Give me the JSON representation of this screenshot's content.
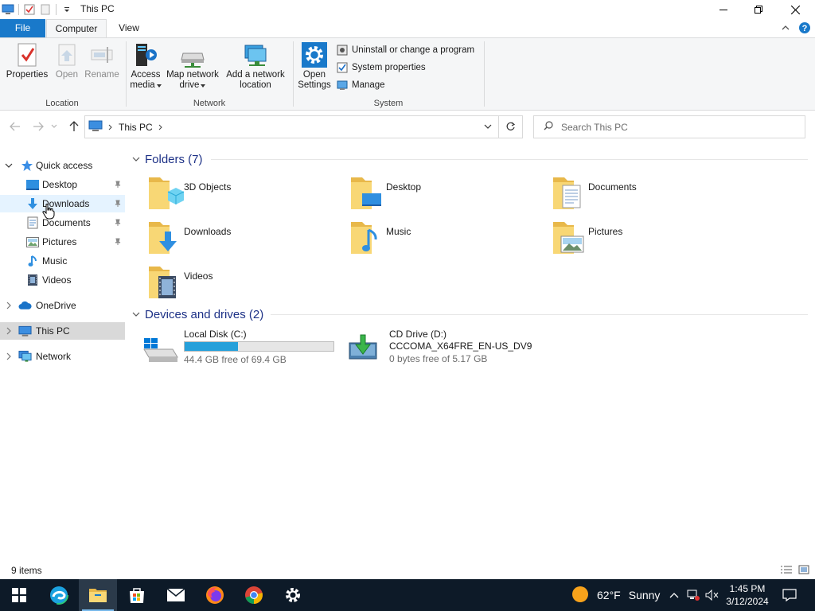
{
  "window": {
    "title": "This PC"
  },
  "ribbon": {
    "tabs": [
      {
        "label": "File"
      },
      {
        "label": "Computer"
      },
      {
        "label": "View"
      }
    ],
    "groups": {
      "location": {
        "label": "Location",
        "buttons": [
          {
            "label": "Properties"
          },
          {
            "label": "Open"
          },
          {
            "label": "Rename"
          }
        ]
      },
      "network": {
        "label": "Network",
        "buttons": [
          {
            "label1": "Access",
            "label2": "media"
          },
          {
            "label1": "Map network",
            "label2": "drive"
          },
          {
            "label1": "Add a network",
            "label2": "location"
          }
        ]
      },
      "system": {
        "label": "System",
        "open_settings_1": "Open",
        "open_settings_2": "Settings",
        "small": [
          {
            "label": "Uninstall or change a program"
          },
          {
            "label": "System properties"
          },
          {
            "label": "Manage"
          }
        ]
      }
    }
  },
  "address": {
    "crumb": "This PC",
    "search_placeholder": "Search This PC"
  },
  "navpane": {
    "items": [
      {
        "label": "Quick access"
      },
      {
        "label": "Desktop"
      },
      {
        "label": "Downloads"
      },
      {
        "label": "Documents"
      },
      {
        "label": "Pictures"
      },
      {
        "label": "Music"
      },
      {
        "label": "Videos"
      },
      {
        "label": "OneDrive"
      },
      {
        "label": "This PC"
      },
      {
        "label": "Network"
      }
    ]
  },
  "content": {
    "folders_header": "Folders (7)",
    "folders": [
      {
        "label": "3D Objects"
      },
      {
        "label": "Desktop"
      },
      {
        "label": "Documents"
      },
      {
        "label": "Downloads"
      },
      {
        "label": "Music"
      },
      {
        "label": "Pictures"
      },
      {
        "label": "Videos"
      }
    ],
    "drives_header": "Devices and drives (2)",
    "drives": [
      {
        "name": "Local Disk (C:)",
        "free": "44.4 GB free of 69.4 GB",
        "used_fraction": 0.36
      },
      {
        "name": "CD Drive (D:)",
        "label": "CCCOMA_X64FRE_EN-US_DV9",
        "free": "0 bytes free of 5.17 GB"
      }
    ]
  },
  "status": {
    "items_count": "9 items"
  },
  "taskbar": {
    "weather_temp": "62°F",
    "weather_text": "Sunny",
    "time": "1:45 PM",
    "date": "3/12/2024"
  },
  "colors": {
    "accent": "#1979ca",
    "folder": "#f8d775",
    "drive_bar": "#26a0da",
    "taskbar": "#0d1a28",
    "header_blue": "#1e3287"
  }
}
